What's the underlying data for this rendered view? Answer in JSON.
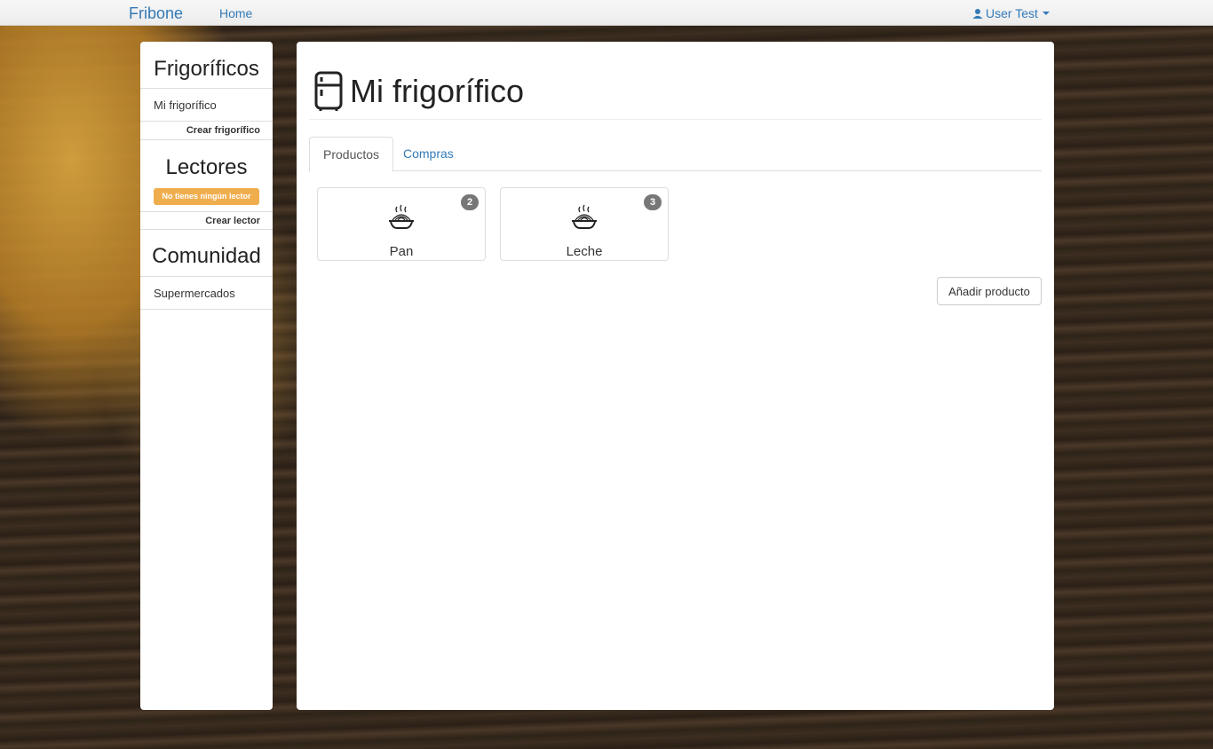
{
  "navbar": {
    "brand": "Fribone",
    "home": "Home",
    "user": "User Test"
  },
  "sidebar": {
    "fridges": {
      "title": "Frigoríficos",
      "items": [
        "Mi frigorífico"
      ],
      "action": "Crear frigorífico"
    },
    "readers": {
      "title": "Lectores",
      "badge": "No tienes ningún lector",
      "action": "Crear lector"
    },
    "community": {
      "title": "Comunidad",
      "items": [
        "Supermercados"
      ]
    }
  },
  "main": {
    "title": "Mi frigorífico",
    "tabs": [
      {
        "label": "Productos",
        "active": true
      },
      {
        "label": "Compras",
        "active": false
      }
    ],
    "products": [
      {
        "name": "Pan",
        "count": "2",
        "icon": "food-bowl-icon"
      },
      {
        "name": "Leche",
        "count": "3",
        "icon": "food-bowl-icon"
      }
    ],
    "add_button": "Añadir producto"
  },
  "colors": {
    "link": "#337ab7",
    "warning": "#f0ad4e",
    "badge": "#777777"
  }
}
